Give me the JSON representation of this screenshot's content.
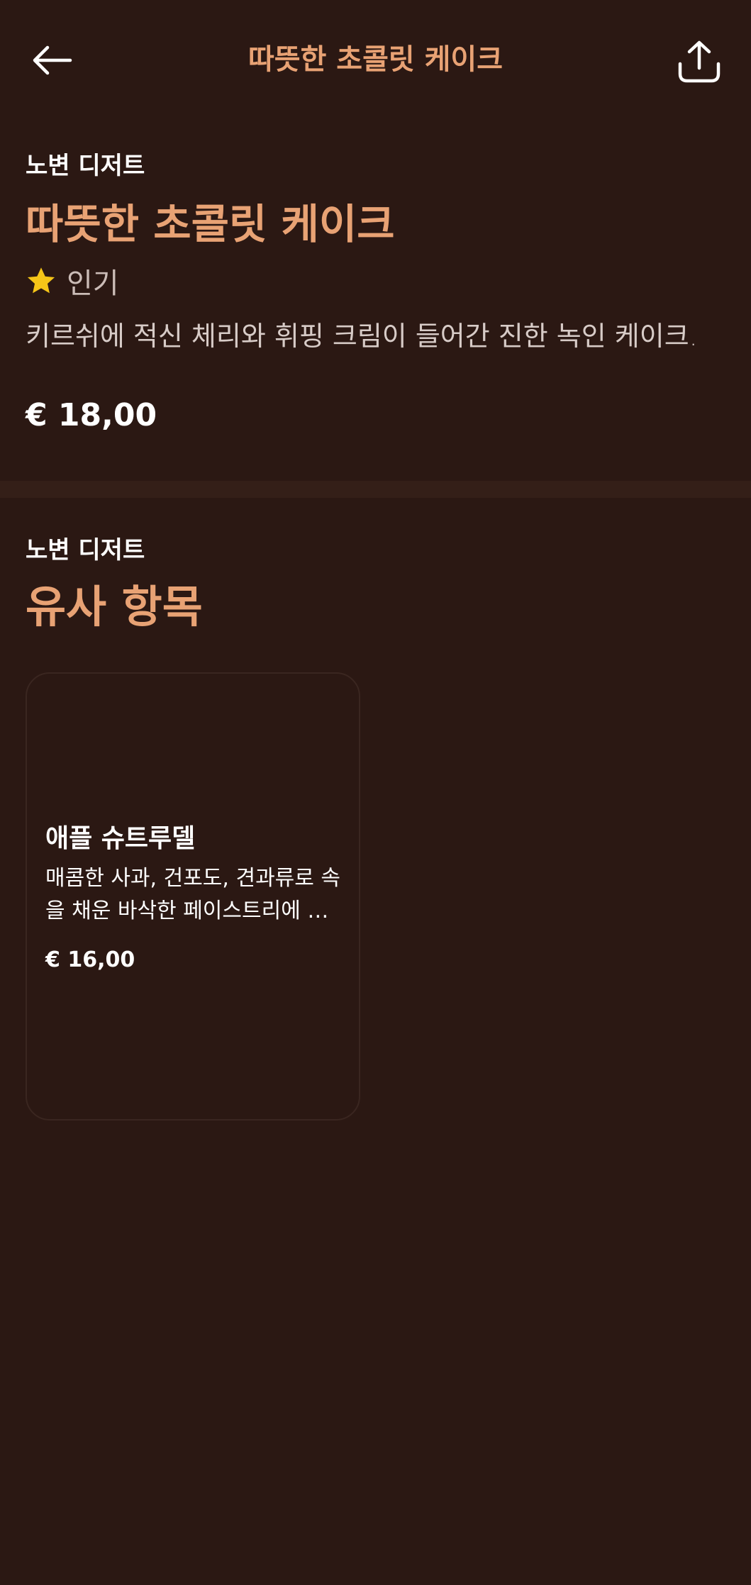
{
  "header": {
    "title": "따뜻한 초콜릿 케이크",
    "back_icon": "arrow-left-icon",
    "share_icon": "share-icon"
  },
  "product": {
    "category": "노변 디저트",
    "title": "따뜻한 초콜릿 케이크",
    "badge": "인기",
    "badge_icon": "star-icon",
    "description": "키르쉬에 적신 체리와 휘핑 크림이 들어간 진한 녹인 케이크.",
    "price": "€ 18,00"
  },
  "similar": {
    "category": "노변 디저트",
    "title": "유사 항목",
    "items": [
      {
        "title": "애플 슈트루델",
        "description": "매콤한 사과, 건포도, 견과류로 속을 채운 바삭한 페이스트리에 바닐라 소스를 곁들인 디저트",
        "price": "€ 16,00"
      }
    ]
  },
  "colors": {
    "background": "#2b1813",
    "accent": "#e8a274",
    "star": "#f5c518"
  }
}
